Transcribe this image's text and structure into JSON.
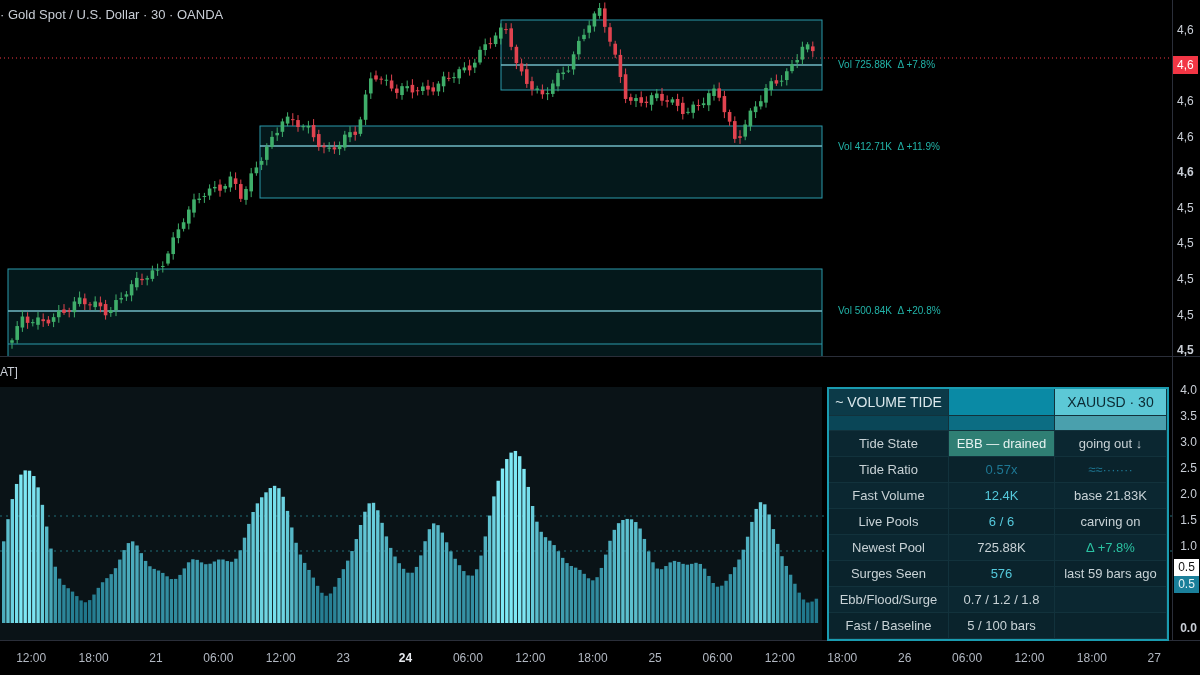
{
  "chart_title": "· Gold Spot / U.S. Dollar · 30 · OANDA",
  "price_axis": [
    {
      "label": "4,6",
      "kind": "tick",
      "emphasized": false
    },
    {
      "label": "4,6",
      "kind": "current",
      "emphasized": false
    },
    {
      "label": "4,6",
      "kind": "tick",
      "emphasized": false
    },
    {
      "label": "4,6",
      "kind": "tick",
      "emphasized": false
    },
    {
      "label": "4,6",
      "kind": "tick",
      "emphasized": true
    },
    {
      "label": "4,5",
      "kind": "tick",
      "emphasized": false
    },
    {
      "label": "4,5",
      "kind": "tick",
      "emphasized": false
    },
    {
      "label": "4,5",
      "kind": "tick",
      "emphasized": false
    },
    {
      "label": "4,5",
      "kind": "tick",
      "emphasized": false
    },
    {
      "label": "4,5",
      "kind": "tick",
      "emphasized": true
    }
  ],
  "pools": [
    {
      "label": "Vol 725.88K  Δ +7.8%"
    },
    {
      "label": "Vol 412.71K  Δ +11.9%"
    },
    {
      "label": "Vol 500.84K  Δ +20.8%"
    }
  ],
  "indicator_label": "AT]",
  "indicator_axis": [
    {
      "label": "4.0",
      "kind": "tick",
      "emphasized": false
    },
    {
      "label": "3.5",
      "kind": "tick",
      "emphasized": false
    },
    {
      "label": "3.0",
      "kind": "tick",
      "emphasized": false
    },
    {
      "label": "2.5",
      "kind": "tick",
      "emphasized": false
    },
    {
      "label": "2.0",
      "kind": "tick",
      "emphasized": false
    },
    {
      "label": "1.5",
      "kind": "tick",
      "emphasized": false
    },
    {
      "label": "1.0",
      "kind": "tick",
      "emphasized": false
    },
    {
      "label": "0.5",
      "kind": "marker-light",
      "emphasized": false
    },
    {
      "label": "0.5",
      "kind": "marker-teal",
      "emphasized": false
    },
    {
      "label": "0.0",
      "kind": "tick",
      "emphasized": true
    }
  ],
  "panel": {
    "title": "~ VOLUME TIDE",
    "symbol": "XAUUSD · 30",
    "rows": [
      {
        "label": "Tide State",
        "value": {
          "text": "EBB — drained",
          "kind": "badge"
        },
        "note": {
          "text": "going out ↓",
          "kind": "plain"
        }
      },
      {
        "label": "Tide Ratio",
        "value": {
          "text": "0.57x",
          "kind": "dim"
        },
        "note": {
          "text": "≈≈·······",
          "kind": "dim"
        }
      },
      {
        "label": "Fast Volume",
        "value": {
          "text": "12.4K",
          "kind": "accent"
        },
        "note": {
          "text": "base 21.83K",
          "kind": "plain"
        }
      },
      {
        "label": "Live Pools",
        "value": {
          "text": "6 / 6",
          "kind": "accent"
        },
        "note": {
          "text": "carving on",
          "kind": "plain"
        }
      },
      {
        "label": "Newest Pool",
        "value": {
          "text": "725.88K",
          "kind": "plain"
        },
        "note": {
          "text": "Δ +7.8%",
          "kind": "positive"
        }
      },
      {
        "label": "Surges Seen",
        "value": {
          "text": "576",
          "kind": "accent"
        },
        "note": {
          "text": "last 59 bars ago",
          "kind": "plain"
        }
      },
      {
        "label": "Ebb/Flood/Surge",
        "value": {
          "text": "0.7 / 1.2 / 1.8",
          "kind": "plain"
        }
      },
      {
        "label": "Fast / Baseline",
        "value": {
          "text": "5 / 100 bars",
          "kind": "plain"
        }
      }
    ]
  },
  "time_axis": [
    {
      "label": "12:00",
      "emphasized": false
    },
    {
      "label": "18:00",
      "emphasized": false
    },
    {
      "label": "21",
      "emphasized": false
    },
    {
      "label": "06:00",
      "emphasized": false
    },
    {
      "label": "12:00",
      "emphasized": false
    },
    {
      "label": "23",
      "emphasized": false
    },
    {
      "label": "24",
      "emphasized": true
    },
    {
      "label": "06:00",
      "emphasized": false
    },
    {
      "label": "12:00",
      "emphasized": false
    },
    {
      "label": "18:00",
      "emphasized": false
    },
    {
      "label": "25",
      "emphasized": false
    },
    {
      "label": "06:00",
      "emphasized": false
    },
    {
      "label": "12:00",
      "emphasized": false
    },
    {
      "label": "18:00",
      "emphasized": false
    },
    {
      "label": "26",
      "emphasized": false
    },
    {
      "label": "06:00",
      "emphasized": false
    },
    {
      "label": "12:00",
      "emphasized": false
    },
    {
      "label": "18:00",
      "emphasized": false
    },
    {
      "label": "27",
      "emphasized": false
    }
  ]
}
